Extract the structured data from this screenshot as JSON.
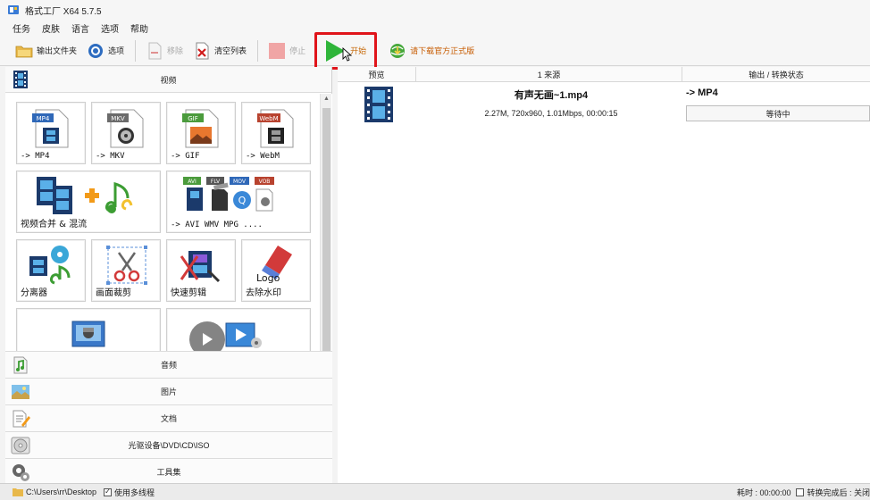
{
  "window": {
    "title": "格式工厂 X64 5.7.5"
  },
  "menu": {
    "items": [
      "任务",
      "皮肤",
      "语言",
      "选项",
      "帮助"
    ]
  },
  "toolbar": {
    "output_folder": "输出文件夹",
    "options": "选项",
    "remove": "移除",
    "clear_list": "清空列表",
    "stop": "停止",
    "start": "开始",
    "download": "请下载官方正式版"
  },
  "left_panel": {
    "video_category": "视频",
    "tiles": [
      {
        "label": "-> MP4",
        "badge": "MP4"
      },
      {
        "label": "-> MKV",
        "badge": "MKV"
      },
      {
        "label": "-> GIF",
        "badge": "GIF"
      },
      {
        "label": "-> WebM",
        "badge": "WebM"
      },
      {
        "label": "视频合并 & 混流"
      },
      {
        "label": "-> AVI WMV MPG ....",
        "badges": [
          "AVI",
          "FLV",
          "MOV",
          "VOB"
        ]
      },
      {
        "label": "分离器"
      },
      {
        "label": "画面裁剪"
      },
      {
        "label": "快速剪辑"
      },
      {
        "label": "去除水印",
        "art_text": "Logo"
      },
      {
        "label": ""
      },
      {
        "label": ""
      }
    ],
    "categories": [
      {
        "label": "音频",
        "icon": "music-note-icon"
      },
      {
        "label": "图片",
        "icon": "picture-icon"
      },
      {
        "label": "文档",
        "icon": "document-icon"
      },
      {
        "label": "光驱设备\\DVD\\CD\\ISO",
        "icon": "disc-icon"
      },
      {
        "label": "工具集",
        "icon": "tools-icon"
      }
    ]
  },
  "task_list": {
    "columns": {
      "preview": "预览",
      "source": "1 来源",
      "output": "输出 / 转换状态"
    },
    "jobs": [
      {
        "filename": "有声无画~1.mp4",
        "meta": "2.27M, 720x960, 1.01Mbps, 00:00:15",
        "target": "-> MP4",
        "status": "等待中"
      }
    ]
  },
  "statusbar": {
    "path": "C:\\Users\\rr\\Desktop",
    "multithread_label": "使用多线程",
    "multithread_checked": true,
    "elapsed": "耗时 : 00:00:00",
    "after_done": "转换完成后 : 关闭"
  },
  "colors": {
    "start_highlight": "#e0141a",
    "start_green": "#2fb53a",
    "link_orange": "#c75b00"
  }
}
